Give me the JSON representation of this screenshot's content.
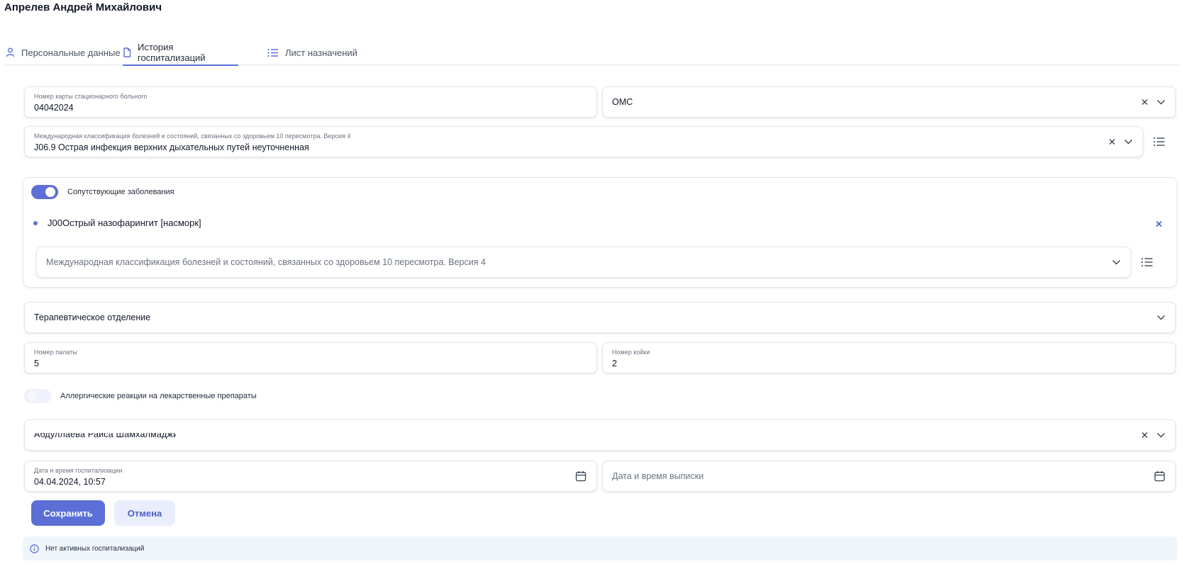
{
  "patient": {
    "name": "Апрелев Андрей Михайлович"
  },
  "tabs": [
    {
      "label": "Персональные данные",
      "icon": "user-icon",
      "active": false
    },
    {
      "label": "История госпитализаций",
      "icon": "document-icon",
      "active": true
    },
    {
      "label": "Лист назначений",
      "icon": "list-icon",
      "active": false
    }
  ],
  "form": {
    "card_number": {
      "label": "Номер карты стационарного больного",
      "value": "04042024"
    },
    "insurance": {
      "value": "ОМС"
    },
    "diagnosis": {
      "label": "Международная классификация болезней и состояний, связанных со здоровьем 10 пересмотра. Версия 4",
      "value": "J06.9 Острая инфекция верхних дыхательных путей неуточненная"
    },
    "comorbid": {
      "toggle_label": "Сопутствующие заболевания",
      "enabled": true,
      "items": [
        {
          "text": "J00Острый назофарингит [насморк]"
        }
      ],
      "select_placeholder": "Международная классификация болезней и состояний, связанных со здоровьем 10 пересмотра. Версия 4"
    },
    "department": {
      "value": "Терапевтическое отделение"
    },
    "ward": {
      "label": "Номер палаты",
      "value": "5"
    },
    "bed": {
      "label": "Номер койки",
      "value": "2"
    },
    "allergy": {
      "toggle_label": "Аллергические реакции на лекарственные препараты",
      "enabled": false
    },
    "doctor": {
      "value": "Абдуллаева Раиса Шамхалмаджиевна"
    },
    "admission": {
      "label": "Дата и время госпитализации",
      "value": "04.04.2024, 10:57"
    },
    "discharge": {
      "placeholder": "Дата и время выписки"
    }
  },
  "actions": {
    "save": "Сохранить",
    "cancel": "Отмена"
  },
  "info": {
    "text": "Нет активных госпитализаций"
  },
  "colors": {
    "accent": "#5b6fd6",
    "info_bg": "#eef6fc",
    "secondary_bg": "#eaeefc"
  }
}
